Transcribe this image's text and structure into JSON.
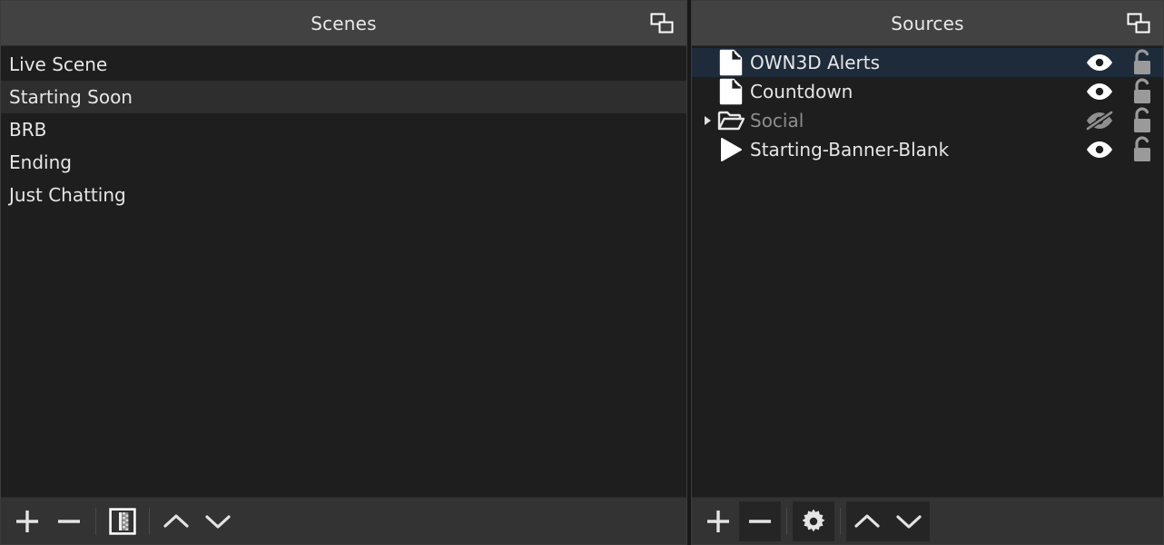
{
  "theme": {
    "bg": "#1e1e1e",
    "panel_header_bg": "#424242",
    "toolbar_bg": "#333333",
    "selection_blue": "#1e2b3a",
    "hover_grey": "#2e2e2e",
    "text": "#e6e6e6",
    "text_dim": "#8d8d8d",
    "lock_grey": "#9a9a9a",
    "border": "#3c3c3c"
  },
  "scenes_panel": {
    "title": "Scenes",
    "float_icon": "float-window-icon",
    "items": [
      {
        "label": "Live Scene",
        "state": "normal"
      },
      {
        "label": "Starting Soon",
        "state": "hovered"
      },
      {
        "label": "BRB",
        "state": "normal"
      },
      {
        "label": "Ending",
        "state": "normal"
      },
      {
        "label": "Just Chatting",
        "state": "normal"
      }
    ],
    "toolbar": [
      {
        "name": "add-scene-button",
        "icon": "plus-icon",
        "label": "Add Scene",
        "raised": false
      },
      {
        "name": "remove-scene-button",
        "icon": "minus-icon",
        "label": "Remove Scene",
        "raised": false
      },
      {
        "name": "separator-1",
        "icon": "separator",
        "label": "",
        "raised": false
      },
      {
        "name": "scene-filters-button",
        "icon": "filters-icon",
        "label": "Scene Filters",
        "raised": false
      },
      {
        "name": "separator-2",
        "icon": "separator",
        "label": "",
        "raised": false
      },
      {
        "name": "move-scene-up-button",
        "icon": "chevron-up-icon",
        "label": "Move Scene Up",
        "raised": false
      },
      {
        "name": "move-scene-down-button",
        "icon": "chevron-down-icon",
        "label": "Move Scene Down",
        "raised": false
      }
    ]
  },
  "sources_panel": {
    "title": "Sources",
    "float_icon": "float-window-icon",
    "items": [
      {
        "label": "OWN3D Alerts",
        "icon": "browser-source-icon",
        "selected": true,
        "dimmed": false,
        "expandable": false,
        "expanded": false,
        "visible": true,
        "visibility_icon": "eye-icon",
        "locked": false,
        "lock_icon": "unlock-icon",
        "indent": 0
      },
      {
        "label": "Countdown",
        "icon": "browser-source-icon",
        "selected": false,
        "dimmed": false,
        "expandable": false,
        "expanded": false,
        "visible": true,
        "visibility_icon": "eye-icon",
        "locked": false,
        "lock_icon": "unlock-icon",
        "indent": 0
      },
      {
        "label": "Social",
        "icon": "folder-open-icon",
        "selected": false,
        "dimmed": true,
        "expandable": true,
        "expanded": false,
        "visible": false,
        "visibility_icon": "eye-slash-icon",
        "locked": false,
        "lock_icon": "unlock-icon",
        "indent": 0
      },
      {
        "label": "Starting-Banner-Blank",
        "icon": "media-play-icon",
        "selected": false,
        "dimmed": false,
        "expandable": false,
        "expanded": false,
        "visible": true,
        "visibility_icon": "eye-icon",
        "locked": false,
        "lock_icon": "unlock-icon",
        "indent": 0
      }
    ],
    "toolbar": [
      {
        "name": "add-source-button",
        "icon": "plus-icon",
        "label": "Add Source",
        "raised": false
      },
      {
        "name": "remove-source-button",
        "icon": "minus-icon",
        "label": "Remove Source",
        "raised": true
      },
      {
        "name": "separator-1",
        "icon": "separator",
        "label": "",
        "raised": false
      },
      {
        "name": "source-properties-button",
        "icon": "gear-icon",
        "label": "Source Properties",
        "raised": true
      },
      {
        "name": "separator-2",
        "icon": "separator",
        "label": "",
        "raised": false
      },
      {
        "name": "move-source-up-button",
        "icon": "chevron-up-icon",
        "label": "Move Source Up",
        "raised": true
      },
      {
        "name": "move-source-down-button",
        "icon": "chevron-down-icon",
        "label": "Move Source Down",
        "raised": true
      }
    ]
  }
}
